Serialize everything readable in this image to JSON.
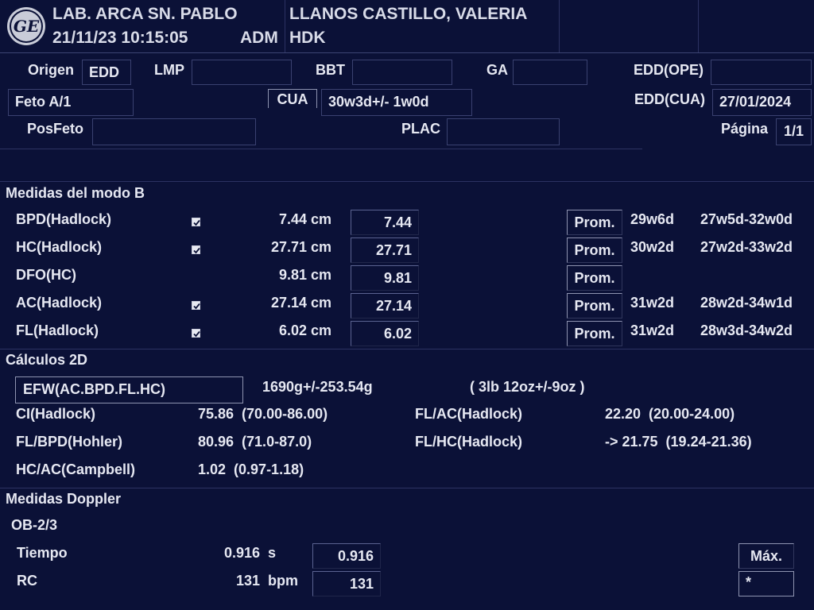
{
  "header": {
    "lab_name": "LAB. ARCA SN. PABLO",
    "datetime": "21/11/23 10:15:05",
    "operator": "ADM",
    "patient_name": "LLANOS CASTILLO, VALERIA",
    "patient_id": "HDK"
  },
  "info": {
    "origen_label": "Origen",
    "origen_value": "EDD",
    "lmp_label": "LMP",
    "lmp_value": "",
    "bbt_label": "BBT",
    "bbt_value": "",
    "ga_label": "GA",
    "ga_value": "",
    "eddope_label": "EDD(OPE)",
    "eddope_value": "",
    "feto_value": "Feto A/1",
    "cua_label": "CUA",
    "cua_value": "30w3d+/- 1w0d",
    "eddcua_label": "EDD(CUA)",
    "eddcua_value": "27/01/2024",
    "posfeto_label": "PosFeto",
    "posfeto_value": "",
    "plac_label": "PLAC",
    "plac_value": "",
    "pagina_label": "Página",
    "pagina_value": "1/1"
  },
  "bmode": {
    "title": "Medidas del modo B",
    "rows": [
      {
        "name": "BPD(Hadlock)",
        "checked": true,
        "measure": "7.44 cm",
        "value": "7.44",
        "button": "Prom.",
        "ga": "29w6d",
        "range": "27w5d-32w0d"
      },
      {
        "name": "HC(Hadlock)",
        "checked": true,
        "measure": "27.71 cm",
        "value": "27.71",
        "button": "Prom.",
        "ga": "30w2d",
        "range": "27w2d-33w2d"
      },
      {
        "name": "DFO(HC)",
        "checked": false,
        "measure": "9.81 cm",
        "value": "9.81",
        "button": "Prom.",
        "ga": "",
        "range": ""
      },
      {
        "name": "AC(Hadlock)",
        "checked": true,
        "measure": "27.14 cm",
        "value": "27.14",
        "button": "Prom.",
        "ga": "31w2d",
        "range": "28w2d-34w1d"
      },
      {
        "name": "FL(Hadlock)",
        "checked": true,
        "measure": "6.02 cm",
        "value": "6.02",
        "button": "Prom.",
        "ga": "31w2d",
        "range": "28w3d-34w2d"
      }
    ]
  },
  "calc2d": {
    "title": "Cálculos 2D",
    "efw_label": "EFW(AC.BPD.FL.HC)",
    "efw_value": "1690g+/-253.54g",
    "efw_lb": "( 3lb 12oz+/-9oz )",
    "ci_label": "CI(Hadlock)",
    "ci_value": "75.86  (70.00-86.00)",
    "flac_label": "FL/AC(Hadlock)",
    "flac_value": "22.20  (20.00-24.00)",
    "flbpd_label": "FL/BPD(Hohler)",
    "flbpd_value": "80.96  (71.0-87.0)",
    "flhc_label": "FL/HC(Hadlock)",
    "flhc_value": "-> 21.75  (19.24-21.36)",
    "hcac_label": "HC/AC(Campbell)",
    "hcac_value": "1.02  (0.97-1.18)"
  },
  "doppler": {
    "title": "Medidas Doppler",
    "subtitle": "OB-2/3",
    "tiempo_label": "Tiempo",
    "tiempo_measure": "0.916",
    "tiempo_unit": "s",
    "tiempo_value": "0.916",
    "rc_label": "RC",
    "rc_measure": "131",
    "rc_unit": "bpm",
    "rc_value": "131",
    "max_button": "Máx.",
    "star_value": "*"
  }
}
